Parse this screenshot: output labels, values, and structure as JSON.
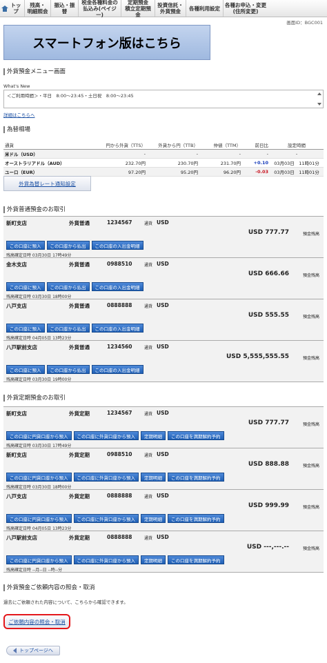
{
  "nav": [
    {
      "label": "トップ",
      "icon": "home-icon"
    },
    {
      "label": "残高・\n明細照会"
    },
    {
      "label": "振込・振替"
    },
    {
      "label": "税金各種料金の\n払込み(ペイジー)"
    },
    {
      "label": "定期預金\n積立定期預金"
    },
    {
      "label": "投資信託・\n外貨預金"
    },
    {
      "label": "各種利用設定"
    },
    {
      "label": "各種お申込・変更\n(住所変更)"
    }
  ],
  "screen_id": "画面ID：BGC001",
  "banner": "スマートフォン版はこちら",
  "menu_title": "外貨預金メニュー画面",
  "whats_new": {
    "label": "What's New",
    "text": "＜ご利用時間＞・平日　8:00〜23:45・土日祝　8:00〜23:45",
    "detail_link": "詳細はこちらへ"
  },
  "rates": {
    "title": "為替相場",
    "headers": [
      "通貨",
      "円から外貨（TTS）",
      "外貨から円（TTB）",
      "仲値（TTM）",
      "前日比",
      "設定時間"
    ],
    "rows": [
      {
        "currency": "米ドル（USD）",
        "tts": "-",
        "ttb": "-",
        "ttm": "-",
        "change": "-",
        "time": "-"
      },
      {
        "currency": "オーストラリアドル（AUD）",
        "tts": "232.70円",
        "ttb": "230.70円",
        "ttm": "231.70円",
        "change": "+0.10",
        "time": "03月03日　11時01分"
      },
      {
        "currency": "ユーロ（EUR）",
        "tts": "97.20円",
        "ttb": "95.20円",
        "ttm": "96.20円",
        "change": "-0.03",
        "time": "03月03日　11時01分"
      }
    ],
    "notify_button": "外貨為替レート通知設定"
  },
  "ordinary": {
    "title": "外貨普通預金のお取引",
    "currency_label": "通貨",
    "balance_label": "預金残高",
    "buttons": [
      "この口座に預入",
      "この口座から払出",
      "この口座の入出金明細"
    ],
    "accounts": [
      {
        "branch": "新町支店",
        "type": "外貨普通",
        "number": "1234567",
        "currency": "USD",
        "balance": "USD 777.77",
        "date": "残高確定日時 03月30日 17時49分"
      },
      {
        "branch": "金木支店",
        "type": "外貨普通",
        "number": "0988510",
        "currency": "USD",
        "balance": "USD 666.66",
        "date": "残高確定日時 03月30日 18時00分"
      },
      {
        "branch": "八戸支店",
        "type": "外貨普通",
        "number": "0888888",
        "currency": "USD",
        "balance": "USD 555.55",
        "date": "残高確定日時 04月05日 13時23分"
      },
      {
        "branch": "八戸駅前支店",
        "type": "外貨普通",
        "number": "1234560",
        "currency": "USD",
        "balance": "USD 5,555,555.55",
        "date": "残高確定日時 03月30日 19時00分"
      }
    ]
  },
  "time_deposit": {
    "title": "外貨定期預金のお取引",
    "currency_label": "通貨",
    "balance_label": "預金残高",
    "buttons": [
      "この口座に円貨口座から預入",
      "この口座に外貨口座から預入",
      "定期明細",
      "この口座を満期解約予約"
    ],
    "accounts": [
      {
        "branch": "新町支店",
        "type": "外貨定期",
        "number": "1234567",
        "currency": "USD",
        "balance": "USD 777.77",
        "date": "残高確定日時 03月30日 17時49分"
      },
      {
        "branch": "新町支店",
        "type": "外貨定期",
        "number": "0988510",
        "currency": "USD",
        "balance": "USD 888.88",
        "date": "残高確定日時 03月30日 18時00分"
      },
      {
        "branch": "八戸支店",
        "type": "外貨定期",
        "number": "0888888",
        "currency": "USD",
        "balance": "USD 999.99",
        "date": "残高確定日時 04月05日 13時23分"
      },
      {
        "branch": "八戸駅前支店",
        "type": "外貨定期",
        "number": "0888888",
        "currency": "USD",
        "balance": "USD ---,---.--",
        "date": "残高確定日時 --月--日 --時--分"
      }
    ]
  },
  "inquiry": {
    "title": "外貨預金ご依頼内容の照会・取消",
    "text": "過去にご依頼された内容について、こちらから確認できます。",
    "button": "ご依頼内容の照会・取消"
  },
  "top_button": "トップページへ"
}
